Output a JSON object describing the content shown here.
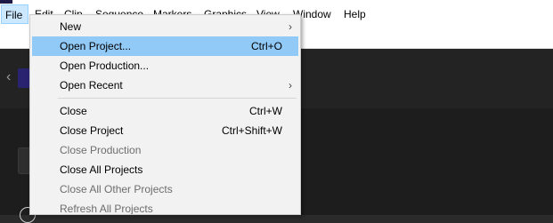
{
  "menubar": {
    "items": [
      {
        "label": "File",
        "active": true
      },
      {
        "label": "Edit"
      },
      {
        "label": "Clip"
      },
      {
        "label": "Sequence"
      },
      {
        "label": "Markers"
      },
      {
        "label": "Graphics"
      },
      {
        "label": "View"
      },
      {
        "label": "Window"
      },
      {
        "label": "Help"
      }
    ]
  },
  "file_menu": {
    "items": [
      {
        "label": "New",
        "shortcut": "",
        "submenu": true,
        "enabled": true
      },
      {
        "label": "Open Project...",
        "shortcut": "Ctrl+O",
        "enabled": true,
        "highlighted": true
      },
      {
        "label": "Open Production...",
        "shortcut": "",
        "enabled": true
      },
      {
        "label": "Open Recent",
        "shortcut": "",
        "submenu": true,
        "enabled": true
      },
      {
        "label": "Close",
        "shortcut": "Ctrl+W",
        "enabled": true
      },
      {
        "label": "Close Project",
        "shortcut": "Ctrl+Shift+W",
        "enabled": true
      },
      {
        "label": "Close Production",
        "shortcut": "",
        "enabled": false
      },
      {
        "label": "Close All Projects",
        "shortcut": "",
        "enabled": true
      },
      {
        "label": "Close All Other Projects",
        "shortcut": "",
        "enabled": false
      },
      {
        "label": "Refresh All Projects",
        "shortcut": "",
        "enabled": false
      }
    ],
    "submenu_glyph": "›"
  },
  "background": {
    "back_glyph": "‹"
  },
  "colors": {
    "menu_highlight": "#91c9f7",
    "menubar_active": "#cce8ff",
    "disabled_text": "#6d6d6d",
    "panel_dark": "#1d1d1d",
    "app_icon": "#2a2470"
  }
}
